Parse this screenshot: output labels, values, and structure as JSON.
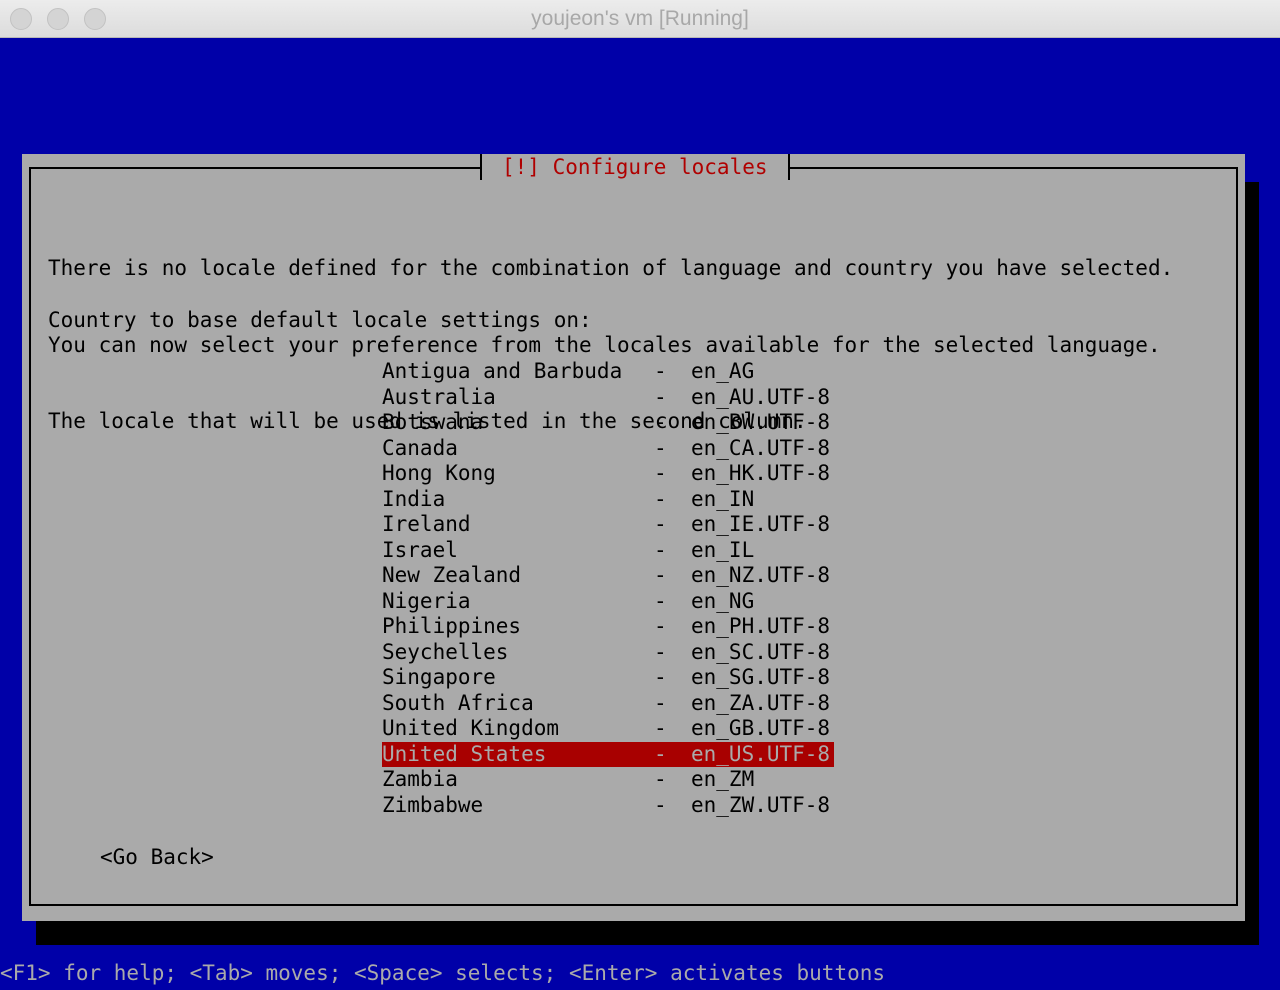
{
  "window": {
    "title": "youjeon's vm [Running]"
  },
  "dialog": {
    "title": "[!] Configure locales",
    "intro_lines": [
      "There is no locale defined for the combination of language and country you have selected.",
      "You can now select your preference from the locales available for the selected language.",
      "The locale that will be used is listed in the second column."
    ],
    "prompt": "Country to base default locale settings on:",
    "dash": "-",
    "countries": [
      {
        "country": "Antigua and Barbuda",
        "locale": "en_AG"
      },
      {
        "country": "Australia",
        "locale": "en_AU.UTF-8"
      },
      {
        "country": "Botswana",
        "locale": "en_BW.UTF-8"
      },
      {
        "country": "Canada",
        "locale": "en_CA.UTF-8"
      },
      {
        "country": "Hong Kong",
        "locale": "en_HK.UTF-8"
      },
      {
        "country": "India",
        "locale": "en_IN"
      },
      {
        "country": "Ireland",
        "locale": "en_IE.UTF-8"
      },
      {
        "country": "Israel",
        "locale": "en_IL"
      },
      {
        "country": "New Zealand",
        "locale": "en_NZ.UTF-8"
      },
      {
        "country": "Nigeria",
        "locale": "en_NG"
      },
      {
        "country": "Philippines",
        "locale": "en_PH.UTF-8"
      },
      {
        "country": "Seychelles",
        "locale": "en_SC.UTF-8"
      },
      {
        "country": "Singapore",
        "locale": "en_SG.UTF-8"
      },
      {
        "country": "South Africa",
        "locale": "en_ZA.UTF-8"
      },
      {
        "country": "United Kingdom",
        "locale": "en_GB.UTF-8"
      },
      {
        "country": "United States",
        "locale": "en_US.UTF-8",
        "selected": true
      },
      {
        "country": "Zambia",
        "locale": "en_ZM"
      },
      {
        "country": "Zimbabwe",
        "locale": "en_ZW.UTF-8"
      }
    ],
    "go_back_label": "<Go Back>"
  },
  "help_line": "<F1> for help; <Tab> moves; <Space> selects; <Enter> activates buttons",
  "colors": {
    "screen_background": "#0000a8",
    "dialog_background": "#aaaaaa",
    "title_color": "#b00000",
    "selection_background": "#a80000"
  }
}
